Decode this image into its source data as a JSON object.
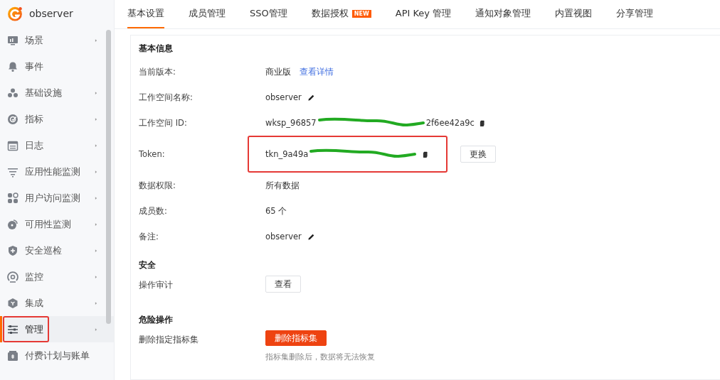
{
  "app": {
    "name": "observer"
  },
  "sidebar": {
    "items": [
      {
        "label": "场景",
        "has_submenu": true,
        "selected": false,
        "annotated": false
      },
      {
        "label": "事件",
        "has_submenu": false,
        "selected": false,
        "annotated": false
      },
      {
        "label": "基础设施",
        "has_submenu": true,
        "selected": false,
        "annotated": false
      },
      {
        "label": "指标",
        "has_submenu": true,
        "selected": false,
        "annotated": false
      },
      {
        "label": "日志",
        "has_submenu": true,
        "selected": false,
        "annotated": false
      },
      {
        "label": "应用性能监测",
        "has_submenu": true,
        "selected": false,
        "annotated": false
      },
      {
        "label": "用户访问监测",
        "has_submenu": true,
        "selected": false,
        "annotated": false
      },
      {
        "label": "可用性监测",
        "has_submenu": true,
        "selected": false,
        "annotated": false
      },
      {
        "label": "安全巡检",
        "has_submenu": true,
        "selected": false,
        "annotated": false
      },
      {
        "label": "监控",
        "has_submenu": true,
        "selected": false,
        "annotated": false
      },
      {
        "label": "集成",
        "has_submenu": true,
        "selected": false,
        "annotated": false
      },
      {
        "label": "管理",
        "has_submenu": true,
        "selected": true,
        "annotated": true
      },
      {
        "label": "付费计划与账单",
        "has_submenu": false,
        "selected": false,
        "annotated": false
      }
    ]
  },
  "tabs": [
    {
      "label": "基本设置",
      "selected": true
    },
    {
      "label": "成员管理",
      "selected": false
    },
    {
      "label": "SSO管理",
      "selected": false
    },
    {
      "label": "数据授权",
      "selected": false,
      "badge": "NEW"
    },
    {
      "label": "API Key 管理",
      "selected": false
    },
    {
      "label": "通知对象管理",
      "selected": false
    },
    {
      "label": "内置视图",
      "selected": false
    },
    {
      "label": "分享管理",
      "selected": false
    }
  ],
  "sections": [
    {
      "title": "基本信息",
      "rows": [
        {
          "kind": "text",
          "label": "当前版本:",
          "value": "商业版",
          "link": "查看详情"
        },
        {
          "kind": "editable",
          "label": "工作空间名称:",
          "value": "observer"
        },
        {
          "kind": "secret",
          "label": "工作空间 ID:",
          "value_start": "wksp_96857",
          "value_end": "2f6ee42a9c",
          "annotated": false
        },
        {
          "kind": "secret",
          "label": "Token:",
          "value_start": "tkn_9a49a",
          "annotated": true,
          "button": "更换"
        },
        {
          "kind": "text",
          "label": "数据权限:",
          "value": "所有数据"
        },
        {
          "kind": "text",
          "label": "成员数:",
          "value": "65 个"
        },
        {
          "kind": "editable",
          "label": "备注:",
          "value": "observer"
        }
      ]
    },
    {
      "title": "安全",
      "rows": [
        {
          "kind": "action",
          "label": "操作审计",
          "button": "查看",
          "danger": false
        }
      ]
    },
    {
      "title": "危险操作",
      "rows": [
        {
          "kind": "action",
          "label": "删除指定指标集",
          "button": "删除指标集",
          "danger": true,
          "hint": "指标集删除后，数据将无法恢复"
        }
      ]
    }
  ]
}
